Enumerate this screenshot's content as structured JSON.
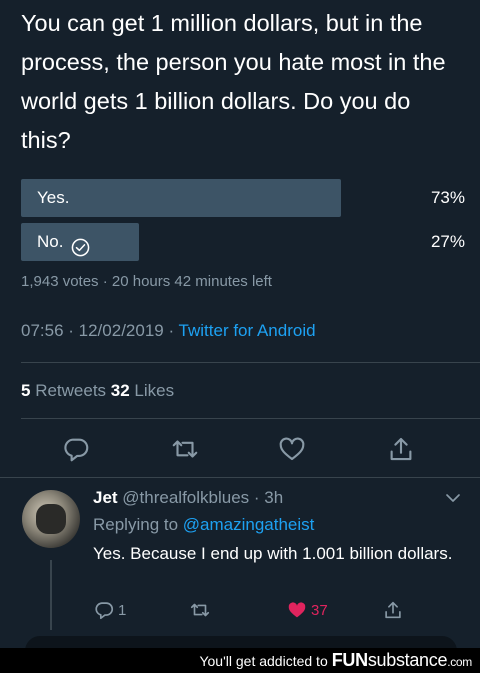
{
  "tweet": {
    "text": "You can get 1 million dollars, but in the process, the person you hate most in the world gets 1 billion dollars. Do you do this?",
    "poll": {
      "options": [
        {
          "label": "Yes.",
          "percent": 73,
          "percent_label": "73%",
          "selected": false
        },
        {
          "label": "No.",
          "percent": 27,
          "percent_label": "27%",
          "selected": true
        }
      ],
      "meta": "1,943 votes · 20 hours 42 minutes left"
    },
    "timestamp": "07:56 · 12/02/2019 · ",
    "source": "Twitter for Android",
    "retweets_count": "5",
    "retweets_label": " Retweets ",
    "likes_count": "32",
    "likes_label": " Likes"
  },
  "actions": [
    "reply-icon",
    "retweet-icon",
    "heart-icon",
    "share-icon"
  ],
  "reply": {
    "name": "Jet",
    "handle_time": " @threalfolkblues · 3h",
    "replying_prefix": "Replying to ",
    "replying_handle": "@amazingatheist",
    "text": "Yes. Because I end up with 1.001 billion dollars.",
    "reply_count": "1",
    "like_count": "37",
    "liked": true
  },
  "watermark": {
    "tagline": "You'll get addicted to",
    "brand_fun": "FUN",
    "brand_sub": "substance",
    "brand_dot": ".com"
  },
  "colors": {
    "background": "#15202b",
    "poll_bar": "#3d5466",
    "link": "#1da1f2",
    "muted": "#8899a6",
    "like": "#e0245e"
  }
}
